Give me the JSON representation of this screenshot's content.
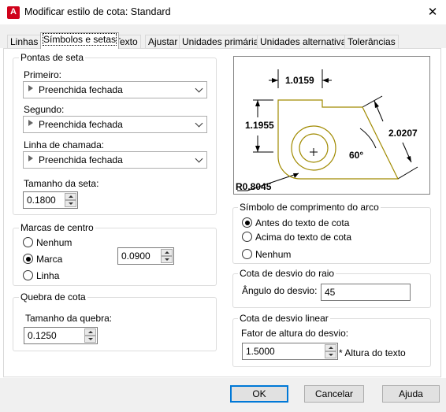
{
  "window": {
    "title": "Modificar estilo de cota: Standard",
    "close_icon": "close-icon",
    "app_icon_letter": "A"
  },
  "tabs": [
    {
      "label": "Linhas"
    },
    {
      "label": "Símbolos e setas"
    },
    {
      "label": "Texto"
    },
    {
      "label": "Ajustar"
    },
    {
      "label": "Unidades primárias"
    },
    {
      "label": "Unidades alternativas"
    },
    {
      "label": "Tolerâncias"
    }
  ],
  "arrowheads": {
    "legend": "Pontas de seta",
    "first_label": "Primeiro:",
    "first_value": "Preenchida fechada",
    "second_label": "Segundo:",
    "second_value": "Preenchida fechada",
    "leader_label": "Linha de chamada:",
    "leader_value": "Preenchida fechada",
    "size_label": "Tamanho da seta:",
    "size_value": "0.1800"
  },
  "center_marks": {
    "legend": "Marcas de centro",
    "options": [
      "Nenhum",
      "Marca",
      "Linha"
    ],
    "selected": "Marca",
    "size_value": "0.0900"
  },
  "dim_break": {
    "legend": "Quebra de cota",
    "size_label": "Tamanho da quebra:",
    "size_value": "0.1250"
  },
  "preview": {
    "dim_top": "1.0159",
    "dim_left": "1.1955",
    "dim_diag": "2.0207",
    "dim_angle": "60°",
    "dim_radius": "R0.8045"
  },
  "arc_length": {
    "legend": "Símbolo de comprimento do arco",
    "options": [
      "Antes do texto de cota",
      "Acima do texto de cota",
      "Nenhum"
    ],
    "selected": "Antes do texto de cota"
  },
  "radius_jog": {
    "legend": "Cota de desvio do raio",
    "angle_label": "Ângulo do desvio:",
    "angle_value": "45"
  },
  "linear_jog": {
    "legend": "Cota de desvio linear",
    "height_label": "Fator de altura do desvio:",
    "height_value": "1.5000",
    "suffix": "* Altura do texto"
  },
  "buttons": {
    "ok": "OK",
    "cancel": "Cancelar",
    "help": "Ajuda"
  },
  "colors": {
    "accent": "#0078d7",
    "preview_shape": "#a08a00"
  }
}
